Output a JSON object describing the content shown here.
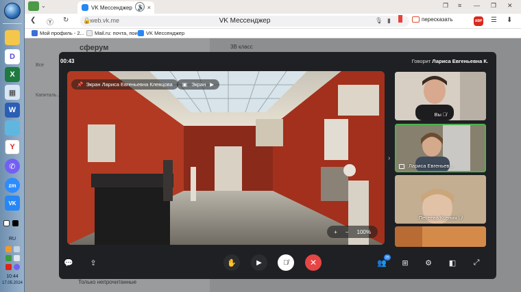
{
  "browser": {
    "tab_title": "VK Мессенджер",
    "url": "web.vk.me",
    "page_title": "VK Мессенджер",
    "translate_label": "пересказать",
    "abp_label": "ABP",
    "new_tab_label": "+"
  },
  "bookmarks": [
    {
      "label": "Мой профиль - 2...",
      "color": "#3b6fd8"
    },
    {
      "label": "Mail.ru: почта, пои...",
      "color": "#eaeaea"
    },
    {
      "label": "VK Мессенджер",
      "color": "#2787f5"
    }
  ],
  "taskbar": {
    "language": "RU",
    "time": "10:44",
    "date": "17.05.2024"
  },
  "background_page": {
    "brand": "сферум",
    "chat_title": "3В класс",
    "side_label_1": "Все",
    "side_label_2": "Капиталь...",
    "footer_text": "Только непрочитанные"
  },
  "call": {
    "timer": "00:43",
    "speaker_prefix": "Говорит",
    "speaker_name": "Лариса Евгеньевна К.",
    "screen_share_label": "Экран Лариса Евгеньевна Клевцова",
    "screen_tag_label": "Экран",
    "zoom_in_label": "+",
    "zoom_out_label": "−",
    "zoom_level": "100%",
    "participants_count": "25",
    "tiles": [
      {
        "name": "Вы",
        "muted": true
      },
      {
        "name": "Лариса Евгеньев...",
        "muted": false,
        "active": true,
        "screen_sharing": true
      },
      {
        "name": "Петеева Ксения",
        "muted": true
      },
      {
        "name": "",
        "muted": false
      }
    ]
  },
  "icons": {
    "chat": "chat-bubble-icon",
    "share_screen": "share-screen-icon",
    "raise_hand": "hand-icon",
    "camera": "camera-icon",
    "mic": "mic-off-icon",
    "end_call": "close-icon",
    "participants": "users-icon",
    "grid": "grid-icon",
    "settings": "gear-icon",
    "picture_in_picture": "pip-icon",
    "fullscreen": "fullscreen-icon"
  },
  "colors": {
    "end_call": "#e64646",
    "active_tile": "#4bb34b",
    "accent": "#2787f5",
    "museum_wall": "#a8341f"
  }
}
